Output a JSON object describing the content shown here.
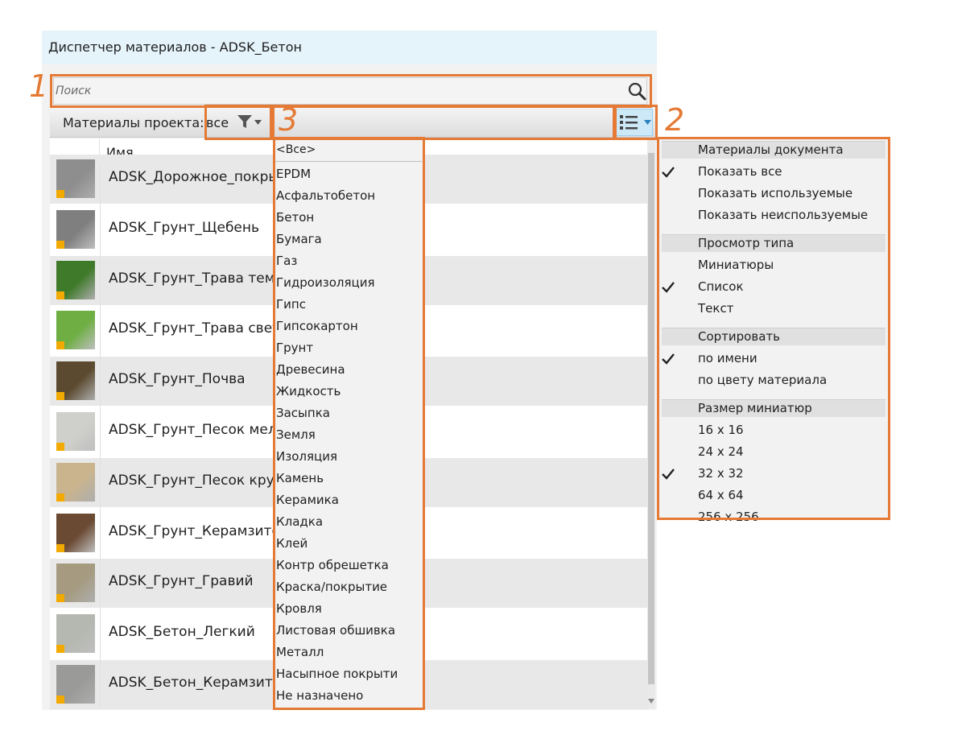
{
  "window": {
    "title": "Диспетчер материалов - ADSK_Бетон"
  },
  "search": {
    "placeholder": "Поиск",
    "icon": "search-icon"
  },
  "toolbar": {
    "label": "Материалы проекта:",
    "filter_value": "все"
  },
  "list": {
    "column_name": "Имя",
    "rows": [
      {
        "name": "ADSK_Дорожное_покрыт",
        "swatch": "#8e8e8e"
      },
      {
        "name": "ADSK_Грунт_Щебень",
        "swatch": "#7f7f7f"
      },
      {
        "name": "ADSK_Грунт_Трава темн",
        "swatch": "#3f7a2a"
      },
      {
        "name": "ADSK_Грунт_Трава светл",
        "swatch": "#6eae42"
      },
      {
        "name": "ADSK_Грунт_Почва",
        "swatch": "#5b4a2f"
      },
      {
        "name": "ADSK_Грунт_Песок мелк",
        "swatch": "#cfcfcb"
      },
      {
        "name": "ADSK_Грунт_Песок круп",
        "swatch": "#c9b48e"
      },
      {
        "name": "ADSK_Грунт_Керамзитов",
        "swatch": "#6b4a33"
      },
      {
        "name": "ADSK_Грунт_Гравий",
        "swatch": "#a69b80"
      },
      {
        "name": "ADSK_Бетон_Легкий",
        "swatch": "#b5b8b1"
      },
      {
        "name": "ADSK_Бетон_Керамзито",
        "swatch": "#9a9a98"
      }
    ]
  },
  "filter_dropdown": {
    "all": "<Все>",
    "items": [
      "EPDM",
      "Асфальтобетон",
      "Бетон",
      "Бумага",
      "Газ",
      "Гидроизоляция",
      "Гипс",
      "Гипсокартон",
      "Грунт",
      "Древесина",
      "Жидкость",
      "Засыпка",
      "Земля",
      "Изоляция",
      "Камень",
      "Керамика",
      "Кладка",
      "Клей",
      "Контр обрешетка",
      "Краска/покрытие",
      "Кровля",
      "Листовая обшивка",
      "Металл",
      "Насыпное покрыти",
      "Не назначено"
    ]
  },
  "view_menu": {
    "sections": [
      {
        "header": "Материалы документа",
        "items": [
          {
            "label": "Показать все",
            "checked": true
          },
          {
            "label": "Показать используемые",
            "checked": false
          },
          {
            "label": "Показать неиспользуемые",
            "checked": false
          }
        ]
      },
      {
        "header": "Просмотр типа",
        "items": [
          {
            "label": "Миниатюры",
            "checked": false
          },
          {
            "label": "Список",
            "checked": true
          },
          {
            "label": "Текст",
            "checked": false
          }
        ]
      },
      {
        "header": "Сортировать",
        "items": [
          {
            "label": "по имени",
            "checked": true
          },
          {
            "label": "по цвету материала",
            "checked": false
          }
        ]
      },
      {
        "header": "Размер миниатюр",
        "items": [
          {
            "label": "16 x 16",
            "checked": false
          },
          {
            "label": "24 x 24",
            "checked": false
          },
          {
            "label": "32 x 32",
            "checked": true
          },
          {
            "label": "64 x 64",
            "checked": false
          },
          {
            "label": "256 x 256",
            "checked": false
          }
        ]
      }
    ]
  },
  "callouts": [
    "1",
    "2",
    "3"
  ],
  "colors": {
    "callout": "#e47a35",
    "titlebar": "#e5f3fb",
    "view_button": "#cde8f7"
  }
}
